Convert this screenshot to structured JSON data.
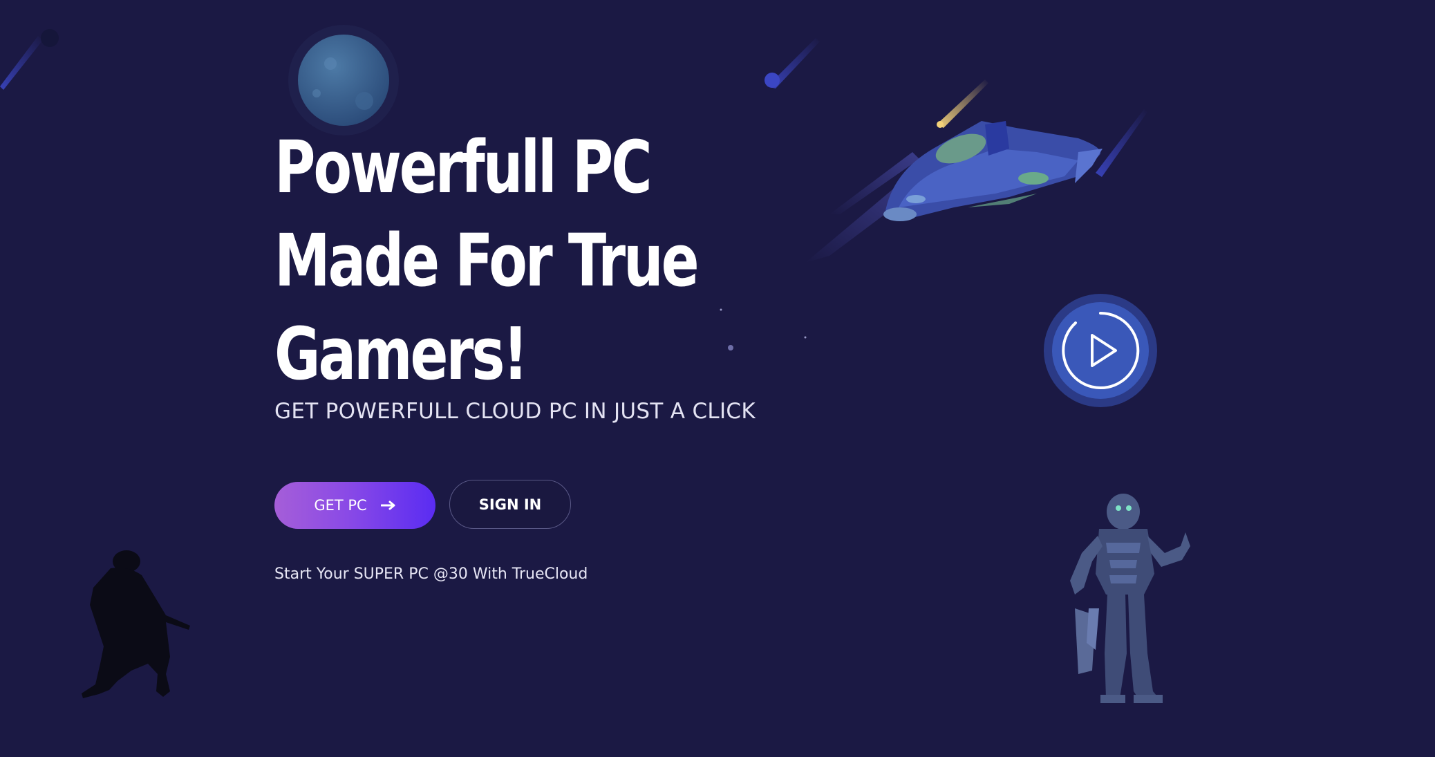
{
  "hero": {
    "title_line1": "Powerfull PC",
    "title_line2": "Made For True",
    "title_line3": "Gamers!",
    "subtitle": "GET POWERFULL CLOUD PC IN JUST A CLICK",
    "tagline": "Start Your SUPER PC @30 With TrueCloud"
  },
  "actions": {
    "primary_label": "GET PC",
    "primary_icon": "arrow-right-icon",
    "secondary_label": "SIGN IN"
  },
  "media": {
    "play_icon": "play-icon"
  },
  "decor": {
    "planet": "planet-icon",
    "spaceship": "spaceship-icon",
    "soldier": "soldier-silhouette",
    "robot": "robot-icon"
  },
  "colors": {
    "background": "#1b1944",
    "primary_gradient_start": "#a55ed8",
    "primary_gradient_end": "#5a2cf2",
    "play_button": "#3a58b9"
  }
}
